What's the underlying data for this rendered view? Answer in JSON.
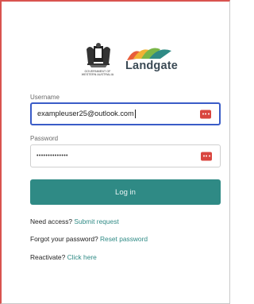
{
  "header": {
    "crest_text_lines": [
      "GOVERNMENT OF",
      "WESTERN AUSTRALIA"
    ],
    "landgate_wordmark": "Landgate"
  },
  "form": {
    "username_label": "Username",
    "username_value": "exampleuser25@outlook.com",
    "password_label": "Password",
    "password_value": "••••••••••••••",
    "password_manager_icon": "password-manager-icon",
    "login_label": "Log in"
  },
  "links": {
    "access_prompt": "Need access?",
    "access_link": "Submit request",
    "forgot_prompt": "Forgot your password?",
    "forgot_link": "Reset password",
    "reactivate_prompt": "Reactivate?",
    "reactivate_link": "Click here"
  },
  "colors": {
    "accent": "#2f8a85",
    "focus_border": "#3a5cc7",
    "icon_red": "#d9453f",
    "brand_text": "#3b4a55"
  }
}
